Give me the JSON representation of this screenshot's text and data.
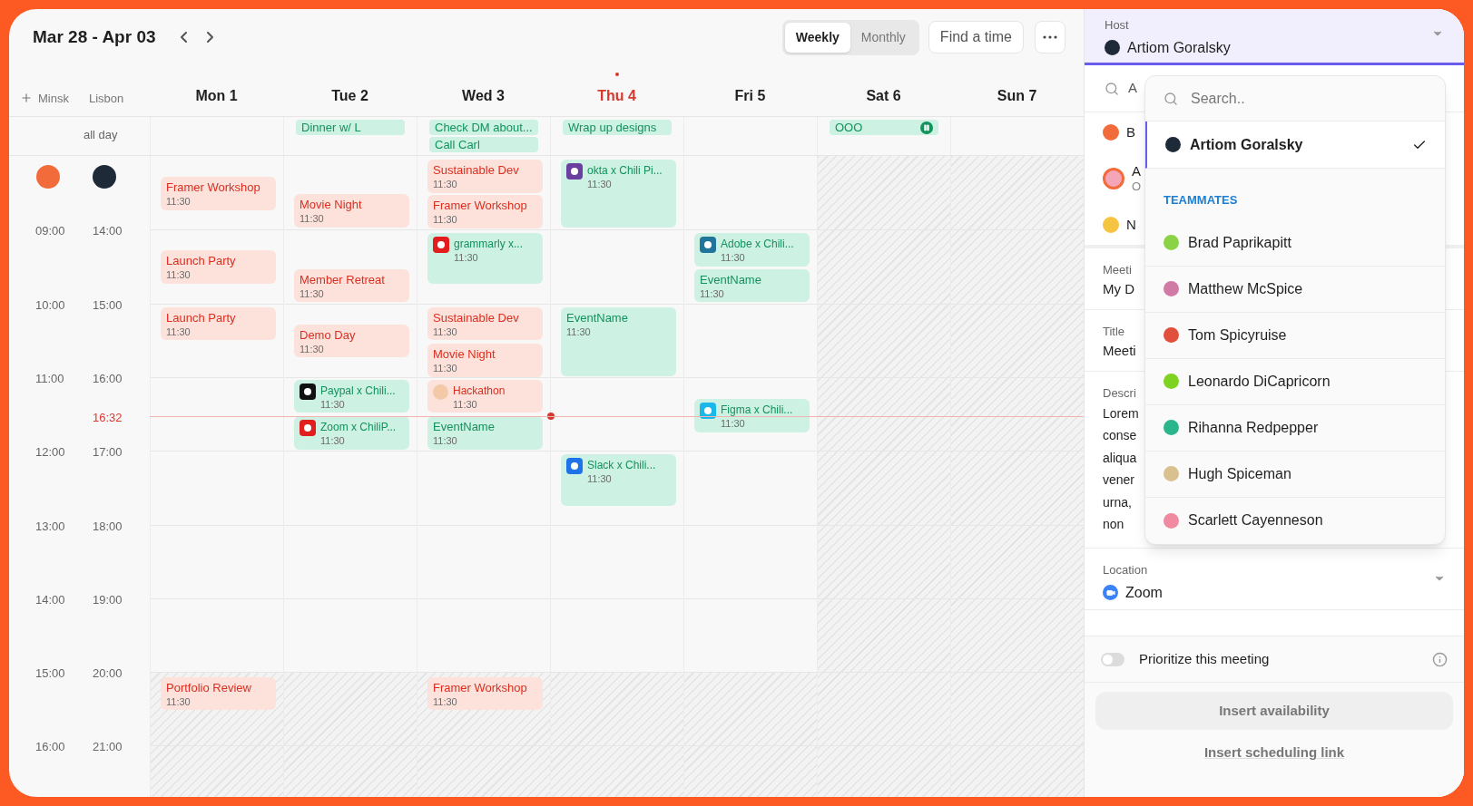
{
  "header": {
    "date_range": "Mar 28 - Apr 03",
    "views": [
      {
        "label": "Weekly",
        "selected": true
      },
      {
        "label": "Monthly",
        "selected": false
      }
    ],
    "find_button": "Find a time"
  },
  "timezones": [
    {
      "label": "Minsk",
      "color": "#f26b3a"
    },
    {
      "label": "Lisbon",
      "color": "#1e2a38"
    }
  ],
  "all_day_label": "all day",
  "days": [
    {
      "label": "Mon 1",
      "today": false,
      "off": false,
      "events": [
        {
          "title": "Framer Workshop",
          "time": "11:30",
          "kind": "busy"
        },
        {
          "title": "Launch Party",
          "time": "11:30",
          "kind": "busy"
        },
        {
          "title": "Launch Party",
          "time": "11:30",
          "kind": "busy"
        },
        {
          "title": "Portfolio Review",
          "time": "11:30",
          "kind": "busy"
        }
      ]
    },
    {
      "label": "Tue 2",
      "today": false,
      "off": false,
      "all_day": [
        {
          "title": "Dinner w/ L",
          "paused": false
        }
      ],
      "events": [
        {
          "title": "Movie Night",
          "time": "11:30",
          "kind": "busy"
        },
        {
          "title": "Member Retreat",
          "time": "11:30",
          "kind": "busy"
        },
        {
          "title": "Demo Day",
          "time": "11:30",
          "kind": "busy"
        },
        {
          "title": "Paypal x Chili...",
          "time": "11:30",
          "kind": "meeting"
        },
        {
          "title": "Zoom x ChiliP...",
          "time": "11:30",
          "kind": "meeting"
        }
      ]
    },
    {
      "label": "Wed 3",
      "today": false,
      "off": false,
      "all_day": [
        {
          "title": "Check DM about...",
          "paused": false
        },
        {
          "title": "Call Carl",
          "paused": false
        }
      ],
      "events": [
        {
          "title": "Sustainable Dev",
          "time": "11:30",
          "kind": "busy"
        },
        {
          "title": "Framer Workshop",
          "time": "11:30",
          "kind": "busy"
        },
        {
          "title": "grammarly x...",
          "time": "11:30",
          "kind": "meeting"
        },
        {
          "title": "Sustainable Dev",
          "time": "11:30",
          "kind": "busy"
        },
        {
          "title": "Movie Night",
          "time": "11:30",
          "kind": "busy"
        },
        {
          "title": "Hackathon",
          "time": "11:30",
          "kind": "busy"
        },
        {
          "title": "EventName",
          "time": "11:30",
          "kind": "meeting"
        },
        {
          "title": "Framer Workshop",
          "time": "11:30",
          "kind": "busy"
        }
      ]
    },
    {
      "label": "Thu 4",
      "today": true,
      "off": false,
      "all_day": [
        {
          "title": "Wrap up designs",
          "paused": false
        }
      ],
      "events": [
        {
          "title": "okta x Chili Pi...",
          "time": "11:30",
          "kind": "meeting"
        },
        {
          "title": "EventName",
          "time": "11:30",
          "kind": "meeting"
        },
        {
          "title": "Slack x Chili...",
          "time": "11:30",
          "kind": "meeting"
        }
      ]
    },
    {
      "label": "Fri 5",
      "today": false,
      "off": false,
      "events": [
        {
          "title": "Adobe x Chili...",
          "time": "11:30",
          "kind": "meeting"
        },
        {
          "title": "EventName",
          "time": "11:30",
          "kind": "meeting"
        },
        {
          "title": "Figma x Chili...",
          "time": "11:30",
          "kind": "meeting"
        }
      ]
    },
    {
      "label": "Sat 6",
      "today": false,
      "off": true,
      "all_day": [
        {
          "title": "OOO",
          "paused": true
        }
      ]
    },
    {
      "label": "Sun 7",
      "today": false,
      "off": true
    }
  ],
  "hours": [
    {
      "primary": "09:00",
      "secondary": "14:00"
    },
    {
      "primary": "10:00",
      "secondary": "15:00"
    },
    {
      "primary": "11:00",
      "secondary": "16:00"
    },
    {
      "primary": "12:00",
      "secondary": "17:00"
    },
    {
      "primary": "13:00",
      "secondary": "18:00"
    },
    {
      "primary": "14:00",
      "secondary": "19:00"
    },
    {
      "primary": "15:00",
      "secondary": "20:00"
    },
    {
      "primary": "16:00",
      "secondary": "21:00"
    }
  ],
  "now": {
    "label": "16:32"
  },
  "panel": {
    "host": {
      "label": "Host",
      "value": "Artiom Goralsky",
      "color": "#1e2a38"
    },
    "search_row": {
      "text": "A"
    },
    "participants": [
      {
        "text": "B",
        "color": "#f26b3a",
        "ring": false
      },
      {
        "text": "A",
        "subtext": "O",
        "color": "#f4a6b8",
        "ring": true
      },
      {
        "text": "N",
        "color": "#f5c542",
        "ring": false
      }
    ],
    "fields": [
      {
        "label": "Meeti",
        "value": "My D"
      },
      {
        "label": "Title",
        "value": "Meeti"
      }
    ],
    "description": {
      "label": "Descri",
      "lines": [
        "Lorem",
        "conse",
        "aliqua",
        "vener",
        "urna,",
        "non"
      ]
    },
    "location": {
      "label": "Location",
      "value": "Zoom"
    },
    "prioritize": {
      "label": "Prioritize this meeting",
      "on": false
    },
    "insert_button": "Insert availability",
    "link": "Insert scheduling link",
    "dropdown": {
      "placeholder": "Search..",
      "current": {
        "name": "Artiom Goralsky",
        "selected": true,
        "color": "#1e2a38"
      },
      "section": "TEAMMATES",
      "teammates": [
        {
          "name": "Brad Paprikapitt",
          "color": "#8bd346",
          "selected": false
        },
        {
          "name": "Matthew McSpice",
          "color": "#d27aa6",
          "selected": false
        },
        {
          "name": "Tom Spicyruise",
          "color": "#e0503c",
          "selected": false
        },
        {
          "name": "Leonardo DiCapricorn",
          "color": "#7ed321",
          "selected": false
        },
        {
          "name": "Rihanna Redpepper",
          "color": "#2bb58a",
          "selected": false
        },
        {
          "name": "Hugh Spiceman",
          "color": "#d9c08f",
          "selected": false
        },
        {
          "name": "Scarlett Cayenneson",
          "color": "#f08aa0",
          "selected": false
        }
      ]
    }
  }
}
